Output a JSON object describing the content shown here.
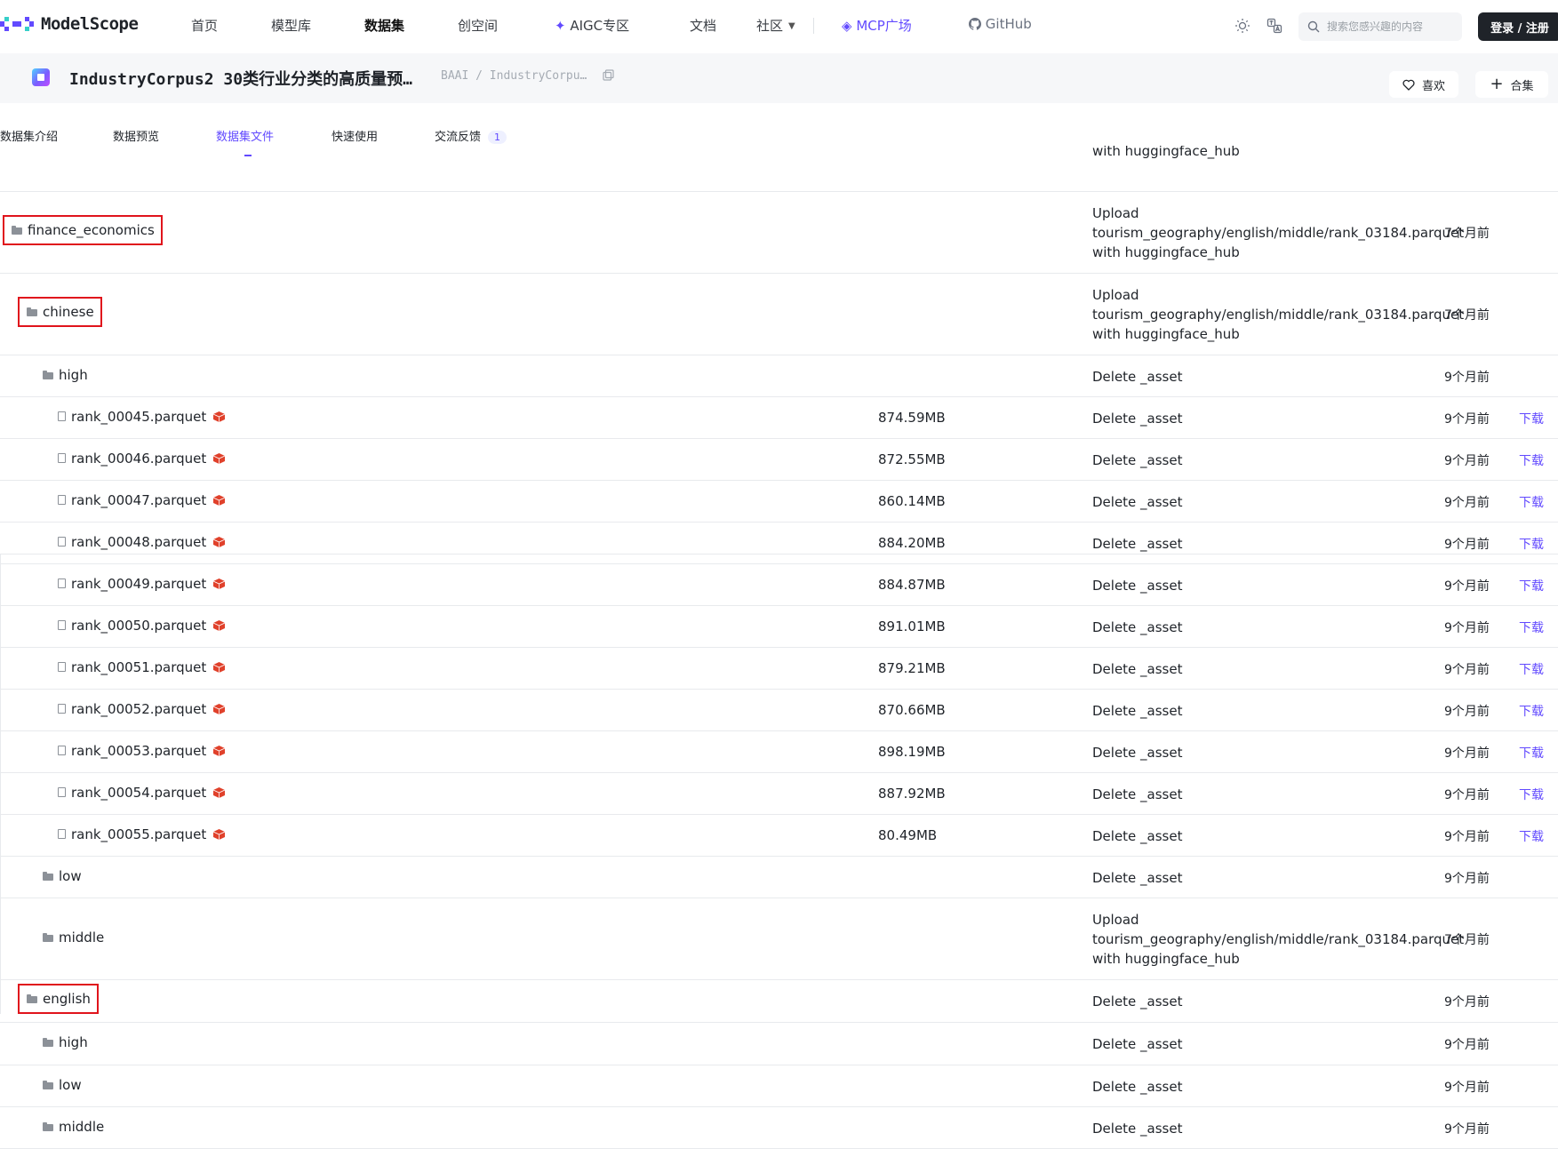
{
  "brand": {
    "logo_text": "ModelScope"
  },
  "nav": {
    "items": [
      "首页",
      "模型库",
      "数据集",
      "创空间",
      "AIGC专区",
      "文档",
      "社区",
      "MCP广场",
      "GitHub"
    ],
    "search_placeholder": "搜索您感兴趣的内容",
    "login_label": "登录 / 注册"
  },
  "dataset": {
    "title": "IndustryCorpus2 30类行业分类的高质量预…",
    "path": "BAAI / IndustryCorpu…",
    "like_label": "喜欢",
    "collect_label": "合集"
  },
  "tabs": [
    {
      "label": "数据集介绍"
    },
    {
      "label": "数据预览"
    },
    {
      "label": "数据集文件"
    },
    {
      "label": "快速使用"
    },
    {
      "label": "交流反馈",
      "badge": "1"
    }
  ],
  "files": {
    "top_partial_commit": "with huggingface_hub",
    "rows": [
      {
        "type": "folder",
        "name": "finance_economics",
        "commit": [
          "Upload",
          "tourism_geography/english/middle/rank_03184.parquet",
          "with huggingface_hub"
        ],
        "time": "7个月前"
      },
      {
        "type": "folder",
        "name": "chinese",
        "commit": [
          "Upload",
          "tourism_geography/english/middle/rank_03184.parquet",
          "with huggingface_hub"
        ],
        "time": "7个月前"
      },
      {
        "type": "folder",
        "name": "high",
        "commit": [
          "Delete _asset"
        ],
        "time": "9个月前"
      },
      {
        "type": "file",
        "name": "rank_00045.parquet",
        "size": "874.59MB",
        "commit": [
          "Delete _asset"
        ],
        "time": "9个月前",
        "download": "下载"
      },
      {
        "type": "file",
        "name": "rank_00046.parquet",
        "size": "872.55MB",
        "commit": [
          "Delete _asset"
        ],
        "time": "9个月前",
        "download": "下载"
      },
      {
        "type": "file",
        "name": "rank_00047.parquet",
        "size": "860.14MB",
        "commit": [
          "Delete _asset"
        ],
        "time": "9个月前",
        "download": "下载"
      },
      {
        "type": "file",
        "name": "rank_00048.parquet",
        "size": "884.20MB",
        "commit": [
          "Delete _asset"
        ],
        "time": "9个月前",
        "download": "下载"
      },
      {
        "type": "file",
        "name": "rank_00049.parquet",
        "size": "884.87MB",
        "commit": [
          "Delete _asset"
        ],
        "time": "9个月前",
        "download": "下载"
      },
      {
        "type": "file",
        "name": "rank_00050.parquet",
        "size": "891.01MB",
        "commit": [
          "Delete _asset"
        ],
        "time": "9个月前",
        "download": "下载"
      },
      {
        "type": "file",
        "name": "rank_00051.parquet",
        "size": "879.21MB",
        "commit": [
          "Delete _asset"
        ],
        "time": "9个月前",
        "download": "下载"
      },
      {
        "type": "file",
        "name": "rank_00052.parquet",
        "size": "870.66MB",
        "commit": [
          "Delete _asset"
        ],
        "time": "9个月前",
        "download": "下载"
      },
      {
        "type": "file",
        "name": "rank_00053.parquet",
        "size": "898.19MB",
        "commit": [
          "Delete _asset"
        ],
        "time": "9个月前",
        "download": "下载"
      },
      {
        "type": "file",
        "name": "rank_00054.parquet",
        "size": "887.92MB",
        "commit": [
          "Delete _asset"
        ],
        "time": "9个月前",
        "download": "下载"
      },
      {
        "type": "file",
        "name": "rank_00055.parquet",
        "size": "80.49MB",
        "commit": [
          "Delete _asset"
        ],
        "time": "9个月前",
        "download": "下载"
      },
      {
        "type": "folder",
        "name": "low",
        "commit": [
          "Delete _asset"
        ],
        "time": "9个月前"
      },
      {
        "type": "folder",
        "name": "middle",
        "commit": [
          "Upload",
          "tourism_geography/english/middle/rank_03184.parquet",
          "with huggingface_hub"
        ],
        "time": "7个月前"
      },
      {
        "type": "folder",
        "name": "english",
        "commit": [
          "Delete _asset"
        ],
        "time": "9个月前"
      },
      {
        "type": "folder",
        "name": "high",
        "commit": [
          "Delete _asset"
        ],
        "time": "9个月前"
      },
      {
        "type": "folder",
        "name": "low",
        "commit": [
          "Delete _asset"
        ],
        "time": "9个月前"
      },
      {
        "type": "folder",
        "name": "middle",
        "commit": [
          "Delete _asset"
        ],
        "time": "9个月前"
      }
    ]
  },
  "colors": {
    "accent": "#624aff",
    "highlight_box": "#e0141c",
    "lfs_icon": "#e0412b"
  }
}
